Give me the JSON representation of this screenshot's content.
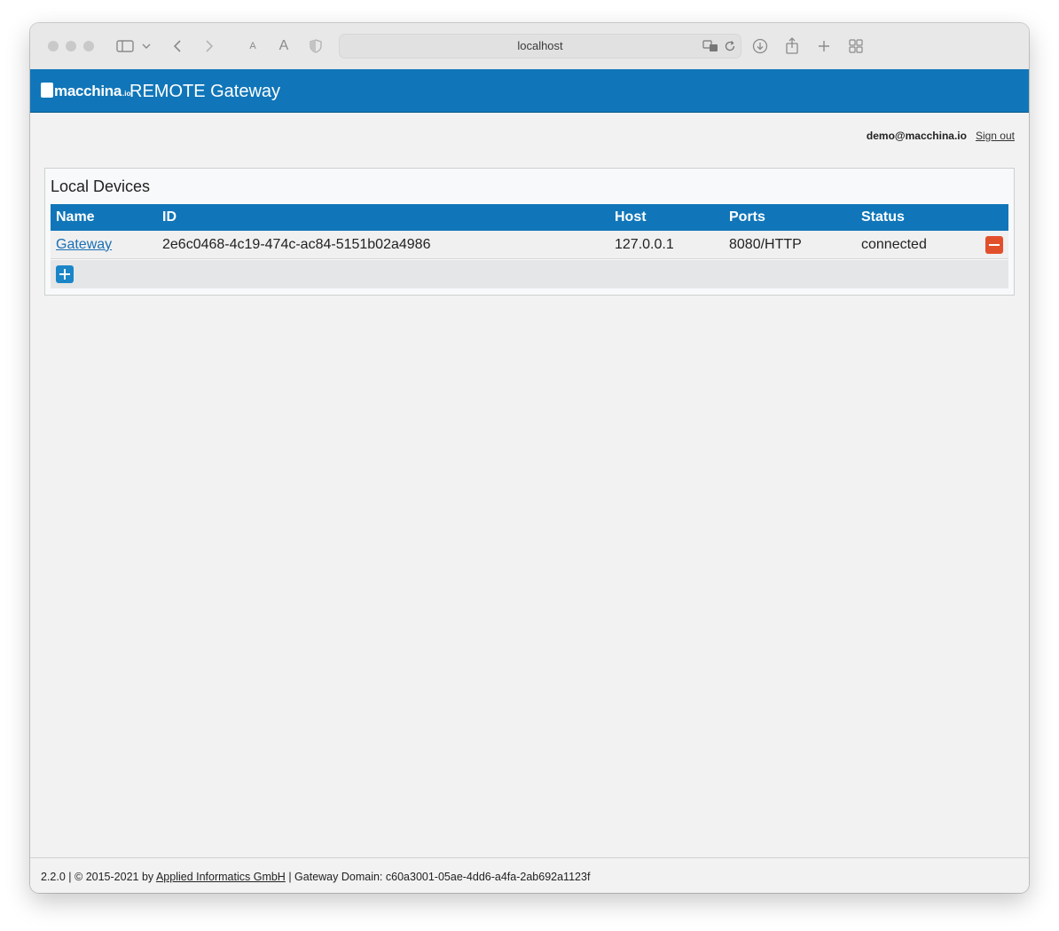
{
  "browser": {
    "url": "localhost",
    "icons": [
      "close-button",
      "minimize-button",
      "zoom-button",
      "sidebar-icon",
      "chevron-down-icon",
      "back-icon",
      "forward-icon",
      "text-smaller-icon",
      "text-larger-icon",
      "shield-icon",
      "translate-icon",
      "reload-icon",
      "download-icon",
      "share-icon",
      "new-tab-icon",
      "tab-overview-icon"
    ],
    "text_small_label": "A",
    "text_large_label": "A"
  },
  "header": {
    "logo_word": "macchina",
    "logo_suffix": ".io",
    "title": "REMOTE Gateway",
    "background": "#1076b9"
  },
  "user": {
    "email": "demo@macchina.io",
    "sign_out_label": "Sign out"
  },
  "panel": {
    "title": "Local Devices",
    "columns": [
      "Name",
      "ID",
      "Host",
      "Ports",
      "Status"
    ],
    "rows": [
      {
        "name": "Gateway",
        "id": "2e6c0468-4c19-474c-ac84-5151b02a4986",
        "host": "127.0.0.1",
        "ports": "8080/HTTP",
        "status": "connected"
      }
    ],
    "remove_color": "#e2502b",
    "add_color": "#1a86c8"
  },
  "footer": {
    "version": "2.2.0",
    "copyright": "© 2015-2021 by",
    "company_link": "Applied Informatics GmbH",
    "domain_label": "Gateway Domain:",
    "domain_id": "c60a3001-05ae-4dd6-a4fa-2ab692a1123f"
  }
}
